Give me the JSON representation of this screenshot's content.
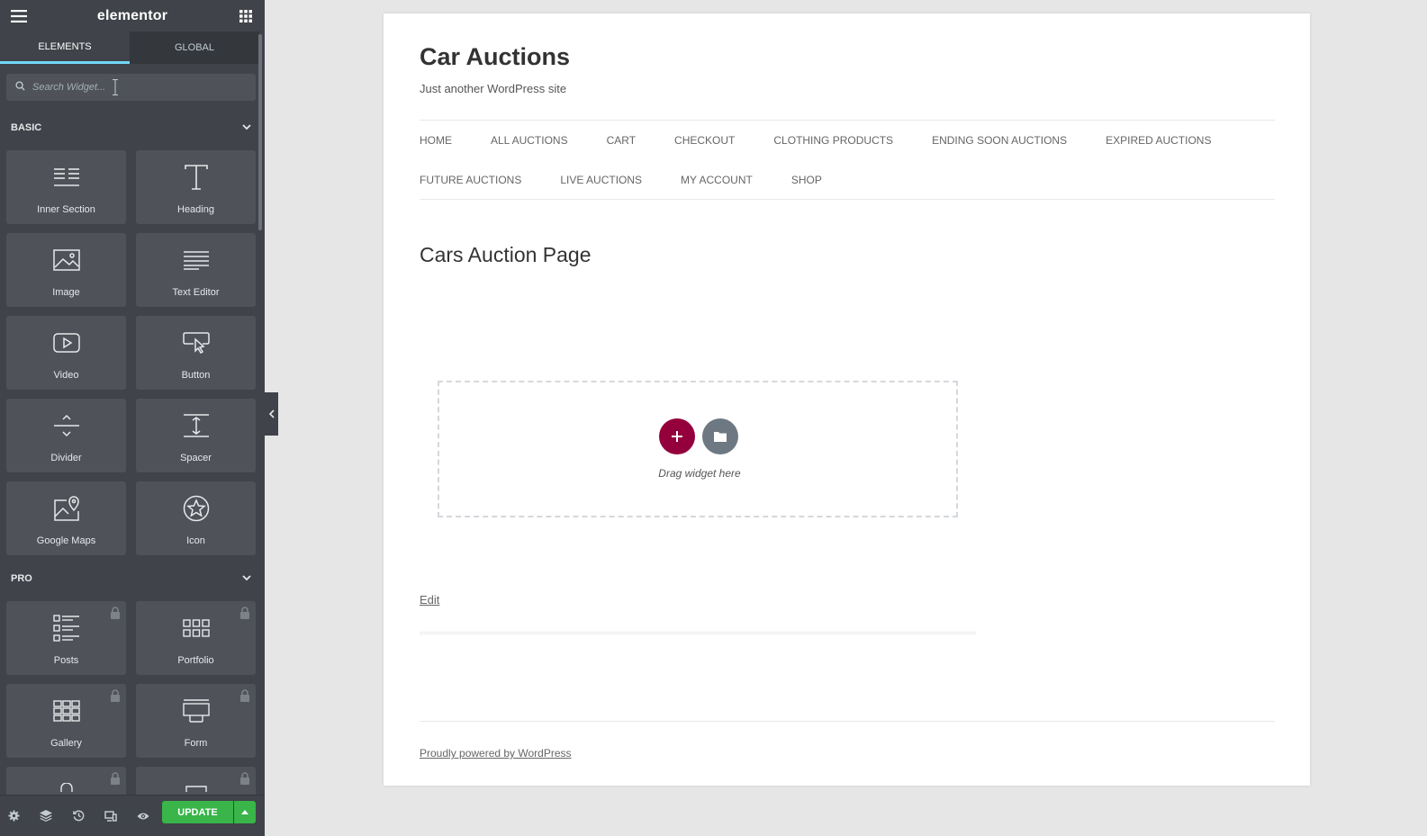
{
  "editor": {
    "brand": "elementor",
    "tabs": [
      {
        "label": "ELEMENTS",
        "active": true
      },
      {
        "label": "GLOBAL",
        "active": false
      }
    ],
    "search": {
      "placeholder": "Search Widget..."
    },
    "categories": [
      {
        "title": "BASIC",
        "widgets": [
          {
            "label": "Inner Section",
            "icon": "inner-section-icon"
          },
          {
            "label": "Heading",
            "icon": "heading-icon"
          },
          {
            "label": "Image",
            "icon": "image-icon"
          },
          {
            "label": "Text Editor",
            "icon": "text-editor-icon"
          },
          {
            "label": "Video",
            "icon": "video-icon"
          },
          {
            "label": "Button",
            "icon": "button-icon"
          },
          {
            "label": "Divider",
            "icon": "divider-icon"
          },
          {
            "label": "Spacer",
            "icon": "spacer-icon"
          },
          {
            "label": "Google Maps",
            "icon": "google-maps-icon"
          },
          {
            "label": "Icon",
            "icon": "star-icon"
          }
        ]
      },
      {
        "title": "PRO",
        "widgets": [
          {
            "label": "Posts",
            "icon": "posts-icon",
            "locked": true
          },
          {
            "label": "Portfolio",
            "icon": "portfolio-icon",
            "locked": true
          },
          {
            "label": "Gallery",
            "icon": "gallery-icon",
            "locked": true
          },
          {
            "label": "Form",
            "icon": "form-icon",
            "locked": true
          }
        ]
      }
    ],
    "footer": {
      "update_label": "UPDATE"
    },
    "colors": {
      "panel": "#404349",
      "accent": "#71d7f7",
      "update": "#39b54a",
      "add": "#93003c"
    }
  },
  "site": {
    "title": "Car Auctions",
    "tagline": "Just another WordPress site",
    "nav_row1": [
      "HOME",
      "ALL AUCTIONS",
      "CART",
      "CHECKOUT",
      "CLOTHING PRODUCTS",
      "ENDING SOON AUCTIONS",
      "EXPIRED AUCTIONS"
    ],
    "nav_row2": [
      "FUTURE AUCTIONS",
      "LIVE AUCTIONS",
      "MY ACCOUNT",
      "SHOP"
    ],
    "page_title": "Cars Auction Page",
    "dropzone_text": "Drag widget here",
    "edit_link": "Edit",
    "powered": "Proudly powered by WordPress"
  }
}
